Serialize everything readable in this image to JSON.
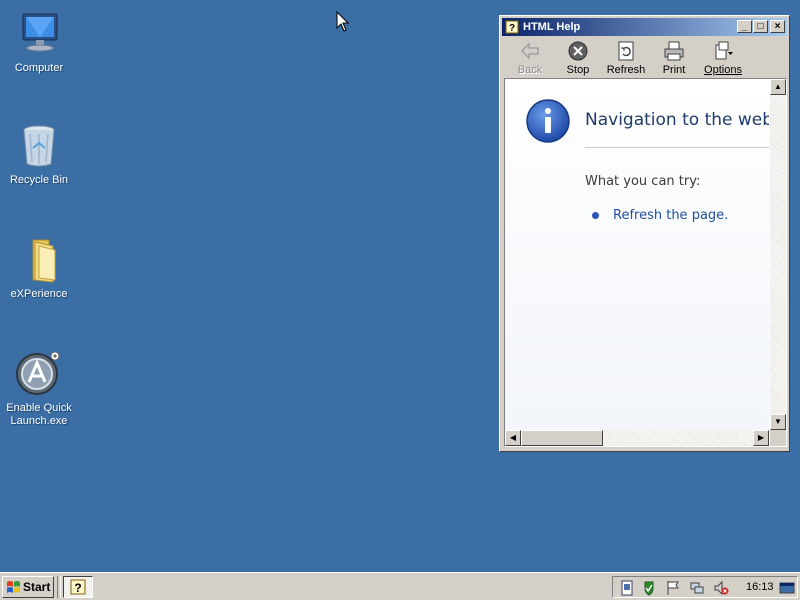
{
  "desktop": {
    "icons": [
      {
        "label": "Computer",
        "icon": "computer-icon"
      },
      {
        "label": "Recycle Bin",
        "icon": "recycle-bin-icon"
      },
      {
        "label": "eXPerience",
        "icon": "folder-icon"
      },
      {
        "label": "Enable Quick Launch.exe",
        "icon": "quick-launch-app-icon"
      }
    ]
  },
  "help_window": {
    "title": "HTML Help",
    "toolbar": {
      "back": "Back",
      "stop": "Stop",
      "refresh": "Refresh",
      "print": "Print",
      "options": "Options"
    },
    "page": {
      "heading": "Navigation to the webpage was canceled",
      "try_label": "What you can try:",
      "refresh_link": "Refresh the page."
    }
  },
  "taskbar": {
    "start_label": "Start",
    "clock": "16:13"
  },
  "colors": {
    "desktop": "#3a6ea5",
    "title_gradient_start": "#0a246a",
    "title_gradient_end": "#a6caf0",
    "link": "#1e4f9c"
  }
}
